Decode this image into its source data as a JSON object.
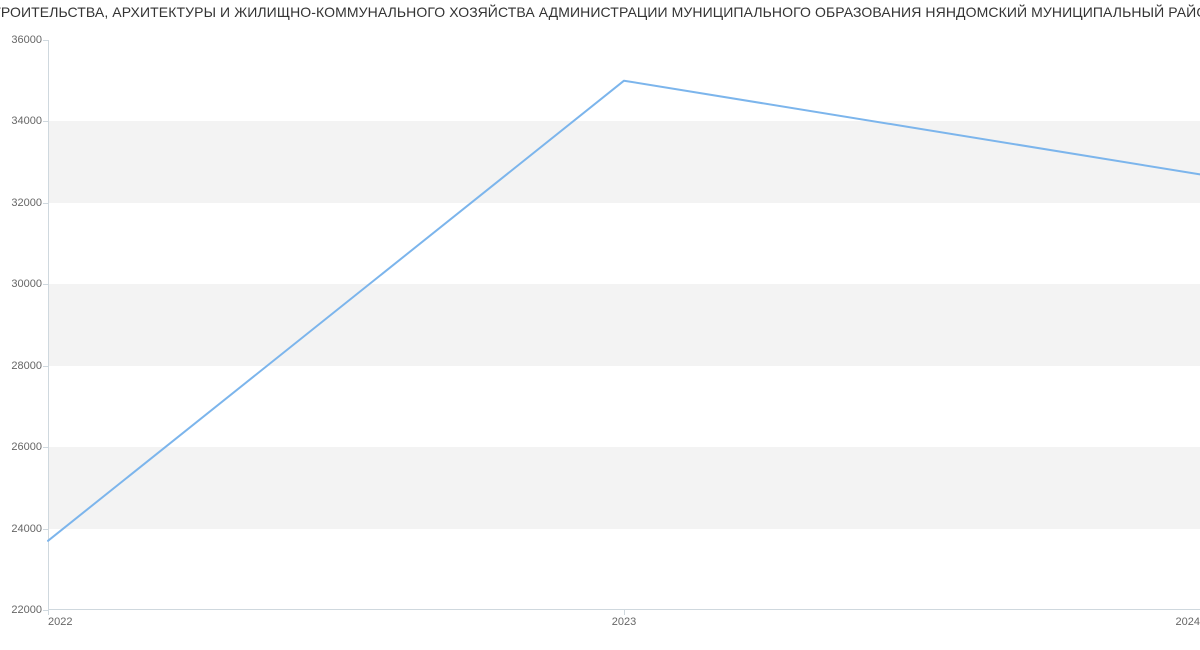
{
  "chart_data": {
    "type": "line",
    "title": "СТРОИТЕЛЬСТВА, АРХИТЕКТУРЫ И ЖИЛИЩНО-КОММУНАЛЬНОГО ХОЗЯЙСТВА АДМИНИСТРАЦИИ МУНИЦИПАЛЬНОГО ОБРАЗОВАНИЯ НЯНДОМСКИЙ МУНИЦИПАЛЬНЫЙ РАЙОН",
    "xlabel": "",
    "ylabel": "",
    "x": [
      2022,
      2023,
      2024
    ],
    "values": [
      23700,
      35000,
      32700
    ],
    "x_ticks": [
      "2022",
      "2023",
      "2024"
    ],
    "y_ticks": [
      22000,
      24000,
      26000,
      28000,
      30000,
      32000,
      34000,
      36000
    ],
    "ylim": [
      22000,
      36000
    ],
    "xlim": [
      2022,
      2024
    ],
    "colors": {
      "line": "#7cb5ec",
      "band": "#f3f3f3",
      "axis": "#cfd8de"
    }
  }
}
